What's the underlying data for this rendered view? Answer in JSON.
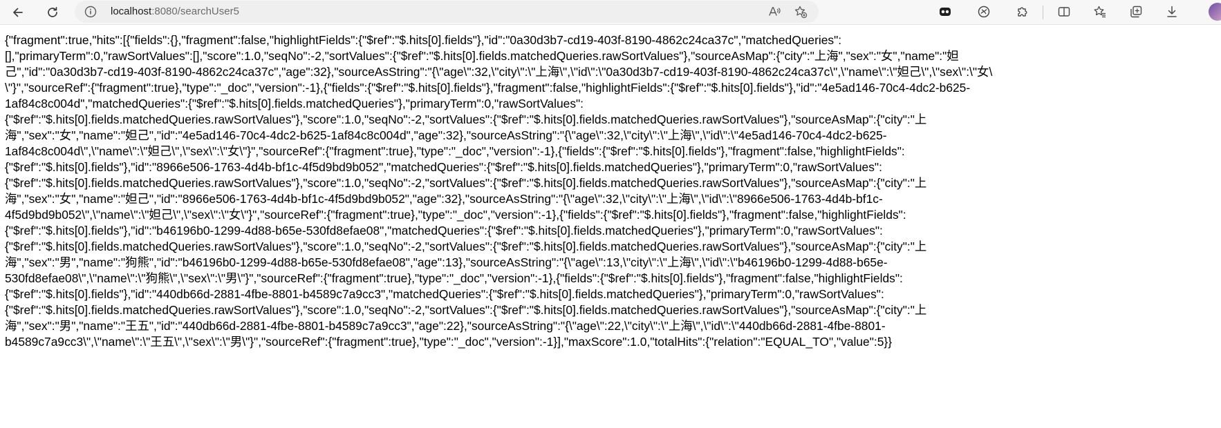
{
  "browser": {
    "url_host": "localhost",
    "url_rest": ":8080/searchUser5",
    "icons": {
      "back": "back-arrow-icon",
      "refresh": "refresh-icon",
      "info": "info-icon",
      "read_aloud": "read-aloud-icon",
      "add_favorite": "add-favorite-icon",
      "extensions": [
        "extension-icon-1",
        "extension-icon-2",
        "puzzle-icon"
      ],
      "split_screen": "split-screen-icon",
      "favorites": "favorites-icon",
      "collections": "collections-icon",
      "downloads": "download-icon",
      "profile": "profile-avatar"
    }
  },
  "response_lines": [
    "{\"fragment\":true,\"hits\":[{\"fields\":{},\"fragment\":false,\"highlightFields\":{\"$ref\":\"$.hits[0].fields\"},\"id\":\"0a30d3b7-cd19-403f-8190-4862c24ca37c\",\"matchedQueries\":",
    "[],\"primaryTerm\":0,\"rawSortValues\":[],\"score\":1.0,\"seqNo\":-2,\"sortValues\":{\"$ref\":\"$.hits[0].fields.matchedQueries.rawSortValues\"},\"sourceAsMap\":{\"city\":\"上海\",\"sex\":\"女\",\"name\":\"妲",
    "己\",\"id\":\"0a30d3b7-cd19-403f-8190-4862c24ca37c\",\"age\":32},\"sourceAsString\":\"{\\\"age\\\":32,\\\"city\\\":\\\"上海\\\",\\\"id\\\":\\\"0a30d3b7-cd19-403f-8190-4862c24ca37c\\\",\\\"name\\\":\\\"妲己\\\",\\\"sex\\\":\\\"女\\",
    "\\\"}\",\"sourceRef\":{\"fragment\":true},\"type\":\"_doc\",\"version\":-1},{\"fields\":{\"$ref\":\"$.hits[0].fields\"},\"fragment\":false,\"highlightFields\":{\"$ref\":\"$.hits[0].fields\"},\"id\":\"4e5ad146-70c4-4dc2-b625-",
    "1af84c8c004d\",\"matchedQueries\":{\"$ref\":\"$.hits[0].fields.matchedQueries\"},\"primaryTerm\":0,\"rawSortValues\":",
    "{\"$ref\":\"$.hits[0].fields.matchedQueries.rawSortValues\"},\"score\":1.0,\"seqNo\":-2,\"sortValues\":{\"$ref\":\"$.hits[0].fields.matchedQueries.rawSortValues\"},\"sourceAsMap\":{\"city\":\"上",
    "海\",\"sex\":\"女\",\"name\":\"妲己\",\"id\":\"4e5ad146-70c4-4dc2-b625-1af84c8c004d\",\"age\":32},\"sourceAsString\":\"{\\\"age\\\":32,\\\"city\\\":\\\"上海\\\",\\\"id\\\":\\\"4e5ad146-70c4-4dc2-b625-",
    "1af84c8c004d\\\",\\\"name\\\":\\\"妲己\\\",\\\"sex\\\":\\\"女\\\"}\",\"sourceRef\":{\"fragment\":true},\"type\":\"_doc\",\"version\":-1},{\"fields\":{\"$ref\":\"$.hits[0].fields\"},\"fragment\":false,\"highlightFields\":",
    "{\"$ref\":\"$.hits[0].fields\"},\"id\":\"8966e506-1763-4d4b-bf1c-4f5d9bd9b052\",\"matchedQueries\":{\"$ref\":\"$.hits[0].fields.matchedQueries\"},\"primaryTerm\":0,\"rawSortValues\":",
    "{\"$ref\":\"$.hits[0].fields.matchedQueries.rawSortValues\"},\"score\":1.0,\"seqNo\":-2,\"sortValues\":{\"$ref\":\"$.hits[0].fields.matchedQueries.rawSortValues\"},\"sourceAsMap\":{\"city\":\"上",
    "海\",\"sex\":\"女\",\"name\":\"妲己\",\"id\":\"8966e506-1763-4d4b-bf1c-4f5d9bd9b052\",\"age\":32},\"sourceAsString\":\"{\\\"age\\\":32,\\\"city\\\":\\\"上海\\\",\\\"id\\\":\\\"8966e506-1763-4d4b-bf1c-",
    "4f5d9bd9b052\\\",\\\"name\\\":\\\"妲己\\\",\\\"sex\\\":\\\"女\\\"}\",\"sourceRef\":{\"fragment\":true},\"type\":\"_doc\",\"version\":-1},{\"fields\":{\"$ref\":\"$.hits[0].fields\"},\"fragment\":false,\"highlightFields\":",
    "{\"$ref\":\"$.hits[0].fields\"},\"id\":\"b46196b0-1299-4d88-b65e-530fd8efae08\",\"matchedQueries\":{\"$ref\":\"$.hits[0].fields.matchedQueries\"},\"primaryTerm\":0,\"rawSortValues\":",
    "{\"$ref\":\"$.hits[0].fields.matchedQueries.rawSortValues\"},\"score\":1.0,\"seqNo\":-2,\"sortValues\":{\"$ref\":\"$.hits[0].fields.matchedQueries.rawSortValues\"},\"sourceAsMap\":{\"city\":\"上",
    "海\",\"sex\":\"男\",\"name\":\"狗熊\",\"id\":\"b46196b0-1299-4d88-b65e-530fd8efae08\",\"age\":13},\"sourceAsString\":\"{\\\"age\\\":13,\\\"city\\\":\\\"上海\\\",\\\"id\\\":\\\"b46196b0-1299-4d88-b65e-",
    "530fd8efae08\\\",\\\"name\\\":\\\"狗熊\\\",\\\"sex\\\":\\\"男\\\"}\",\"sourceRef\":{\"fragment\":true},\"type\":\"_doc\",\"version\":-1},{\"fields\":{\"$ref\":\"$.hits[0].fields\"},\"fragment\":false,\"highlightFields\":",
    "{\"$ref\":\"$.hits[0].fields\"},\"id\":\"440db66d-2881-4fbe-8801-b4589c7a9cc3\",\"matchedQueries\":{\"$ref\":\"$.hits[0].fields.matchedQueries\"},\"primaryTerm\":0,\"rawSortValues\":",
    "{\"$ref\":\"$.hits[0].fields.matchedQueries.rawSortValues\"},\"score\":1.0,\"seqNo\":-2,\"sortValues\":{\"$ref\":\"$.hits[0].fields.matchedQueries.rawSortValues\"},\"sourceAsMap\":{\"city\":\"上",
    "海\",\"sex\":\"男\",\"name\":\"王五\",\"id\":\"440db66d-2881-4fbe-8801-b4589c7a9cc3\",\"age\":22},\"sourceAsString\":\"{\\\"age\\\":22,\\\"city\\\":\\\"上海\\\",\\\"id\\\":\\\"440db66d-2881-4fbe-8801-",
    "b4589c7a9cc3\\\",\\\"name\\\":\\\"王五\\\",\\\"sex\\\":\\\"男\\\"}\",\"sourceRef\":{\"fragment\":true},\"type\":\"_doc\",\"version\":-1}],\"maxScore\":1.0,\"totalHits\":{\"relation\":\"EQUAL_TO\",\"value\":5}}"
  ]
}
